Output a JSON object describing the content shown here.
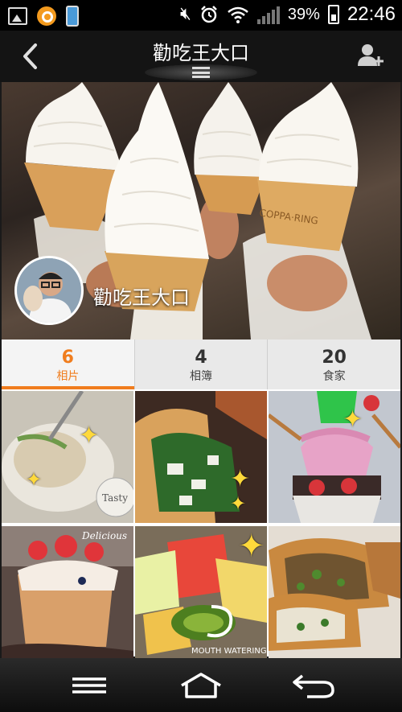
{
  "status_bar": {
    "battery_percent": "39%",
    "time": "22:46",
    "icons": [
      "gallery-icon",
      "app-notification-icon",
      "phone-icon",
      "mute-icon",
      "alarm-icon",
      "wifi-icon",
      "signal-icon",
      "battery-charging-icon"
    ]
  },
  "header": {
    "title": "勸吃王大口",
    "icons": [
      "back-arrow-icon",
      "menu-handle-icon",
      "add-friend-icon"
    ]
  },
  "profile": {
    "name": "勸吃王大口"
  },
  "stats": [
    {
      "count": "6",
      "label": "相片",
      "active": true
    },
    {
      "count": "4",
      "label": "相簿",
      "active": false
    },
    {
      "count": "20",
      "label": "食家",
      "active": false
    }
  ],
  "photo_overlays": {
    "tile1_watermark": "Tasty",
    "tile4_watermark": "Delicious",
    "tile5_watermark": "MOUTH WATERING"
  },
  "nav": {
    "icons": [
      "menu-icon",
      "home-icon",
      "back-icon"
    ]
  },
  "colors": {
    "accent": "#f07d1e",
    "header_bg": "#141414",
    "tab_bg": "#e9e9e9"
  }
}
